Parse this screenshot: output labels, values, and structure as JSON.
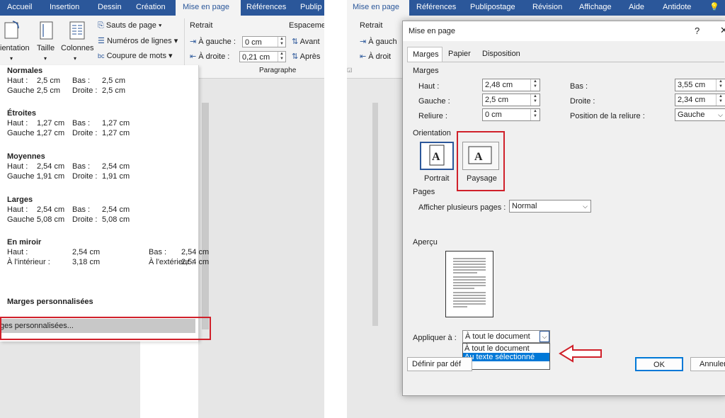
{
  "left": {
    "tabs": [
      "Accueil",
      "Insertion",
      "Dessin",
      "Création",
      "Mise en page",
      "Références",
      "Publip"
    ],
    "ribbon": {
      "orientation_label": "ientation",
      "size_label": "Taille",
      "columns_label": "Colonnes",
      "breaks_label": "Sauts de page",
      "line_numbers_label": "Numéros de lignes",
      "hyphenation_label": "Coupure de mots",
      "indent_title": "Retrait",
      "indent_left_label": "À gauche :",
      "indent_left_value": "0 cm",
      "indent_right_label": "À droite :",
      "indent_right_value": "0,21 cm",
      "spacing_title": "Espaceme",
      "spacing_before": "Avant",
      "spacing_after": "Après",
      "group_paragraph": "Paragraphe"
    },
    "presets": [
      {
        "name": "Normales",
        "l1a": "Haut :",
        "l1b": "2,5 cm",
        "l1c": "Bas :",
        "l1d": "2,5 cm",
        "l2a": "Gauche :",
        "l2b": "2,5 cm",
        "l2c": "Droite :",
        "l2d": "2,5 cm"
      },
      {
        "name": "Étroites",
        "l1a": "Haut :",
        "l1b": "1,27 cm",
        "l1c": "Bas :",
        "l1d": "1,27 cm",
        "l2a": "Gauche :",
        "l2b": "1,27 cm",
        "l2c": "Droite :",
        "l2d": "1,27 cm"
      },
      {
        "name": "Moyennes",
        "l1a": "Haut :",
        "l1b": "2,54 cm",
        "l1c": "Bas :",
        "l1d": "2,54 cm",
        "l2a": "Gauche :",
        "l2b": "1,91 cm",
        "l2c": "Droite :",
        "l2d": "1,91 cm"
      },
      {
        "name": "Larges",
        "l1a": "Haut :",
        "l1b": "2,54 cm",
        "l1c": "Bas :",
        "l1d": "2,54 cm",
        "l2a": "Gauche :",
        "l2b": "5,08 cm",
        "l2c": "Droite :",
        "l2d": "5,08 cm"
      }
    ],
    "mirror": {
      "name": "En miroir",
      "l1a": "Haut :",
      "l1b": "2,54 cm",
      "l1c": "Bas :",
      "l1d": "2,54 cm",
      "l2a": "À l'intérieur :",
      "l2b": "3,18 cm",
      "l2c": "À l'extérieur :",
      "l2d": "2,54 cm"
    },
    "custom_title": "Marges personnalisées",
    "custom_item": "ges personnalisées..."
  },
  "right": {
    "tabs": [
      "Mise en page",
      "Références",
      "Publipostage",
      "Révision",
      "Affichage",
      "Aide",
      "Antidote"
    ],
    "ribbon": {
      "indent_title": "Retrait",
      "indent_left": "À gauch",
      "indent_right": "À droit"
    },
    "dialog": {
      "title": "Mise en page",
      "help": "?",
      "tabs": [
        "Marges",
        "Papier",
        "Disposition"
      ],
      "margins_section": "Marges",
      "top_label": "Haut :",
      "top_value": "2,48 cm",
      "bottom_label": "Bas :",
      "bottom_value": "3,55 cm",
      "left_label": "Gauche :",
      "left_value": "2,5 cm",
      "right_label": "Droite :",
      "right_value": "2,34 cm",
      "gutter_label": "Reliure :",
      "gutter_value": "0 cm",
      "gutter_pos_label": "Position de la reliure :",
      "gutter_pos_value": "Gauche",
      "orientation_section": "Orientation",
      "portrait": "Portrait",
      "landscape": "Paysage",
      "pages_section": "Pages",
      "multiple_pages_label": "Afficher plusieurs pages :",
      "multiple_pages_value": "Normal",
      "preview_section": "Aperçu",
      "apply_label": "Appliquer à :",
      "apply_value": "À tout le document",
      "apply_options": [
        "À tout le document",
        "Au texte sélectionné"
      ],
      "default_button": "Définir par déf",
      "ok_button": "OK",
      "cancel_button": "Annuler"
    }
  },
  "colors": {
    "ribbon_blue": "#2b579a",
    "highlight_red": "#d0202a",
    "selection_blue": "#0078d7"
  }
}
